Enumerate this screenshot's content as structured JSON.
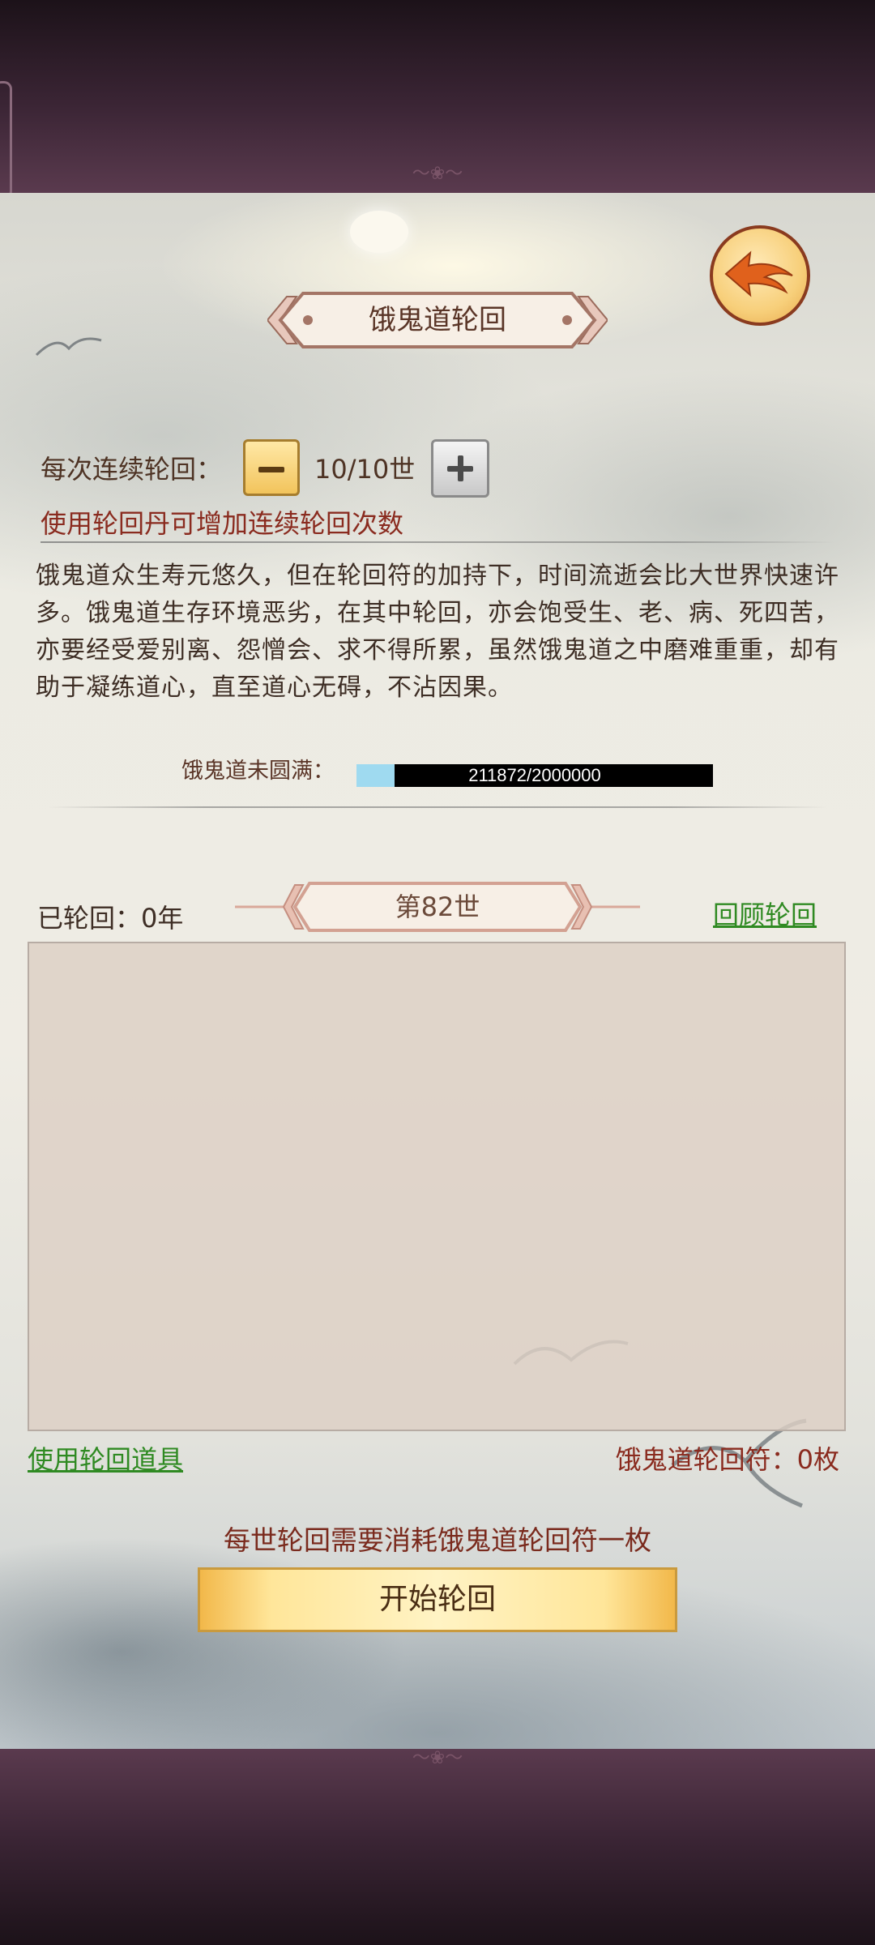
{
  "header": {
    "title": "饿鬼道轮回",
    "ornament": "〜❀〜"
  },
  "continuous": {
    "label": "每次连续轮回：",
    "count": "10/10世",
    "hint": "使用轮回丹可增加连续轮回次数"
  },
  "description": "饿鬼道众生寿元悠久，但在轮回符的加持下，时间流逝会比大世界快速许多。饿鬼道生存环境恶劣，在其中轮回，亦会饱受生、老、病、死四苦，亦要经受爱别离、怨憎会、求不得所累，虽然饿鬼道之中磨难重重，却有助于凝练道心，直至道心无碍，不沾因果。",
  "progress": {
    "label": "饿鬼道未圆满：",
    "text": "211872/2000000",
    "current": 211872,
    "max": 2000000
  },
  "cycle": {
    "cycled": "已轮回：0年",
    "generation": "第82世",
    "review": "回顾轮回"
  },
  "footer": {
    "use_item": "使用轮回道具",
    "talisman": "饿鬼道轮回符：0枚",
    "cost_hint": "每世轮回需要消耗饿鬼道轮回符一枚",
    "start": "开始轮回"
  },
  "colors": {
    "accent_red": "#8a2b1f",
    "link_green": "#2f8a22",
    "progress_fill": "#9fdaf0",
    "button_gold": "#ffe69a"
  },
  "icons": {
    "back": "back-arrow-icon",
    "minus": "minus-icon",
    "plus": "plus-icon"
  }
}
